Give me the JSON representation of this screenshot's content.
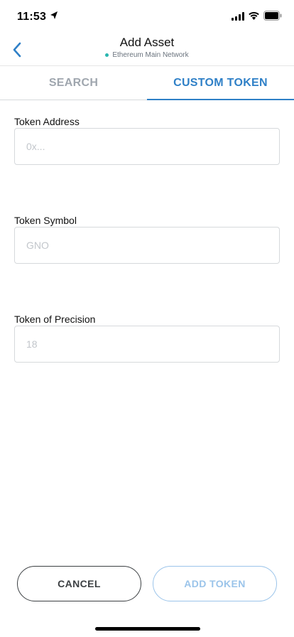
{
  "status_bar": {
    "time": "11:53",
    "icons": [
      "location-arrow-icon",
      "signal-icon",
      "wifi-icon",
      "battery-icon"
    ]
  },
  "header": {
    "title": "Add Asset",
    "network": "Ethereum Main Network",
    "network_status_color": "#29b6af",
    "back_icon": "chevron-left-icon"
  },
  "tabs": [
    {
      "label": "SEARCH",
      "active": false
    },
    {
      "label": "CUSTOM TOKEN",
      "active": true
    }
  ],
  "form": {
    "address": {
      "label": "Token Address",
      "placeholder": "0x...",
      "value": ""
    },
    "symbol": {
      "label": "Token Symbol",
      "placeholder": "GNO",
      "value": ""
    },
    "precision": {
      "label": "Token of Precision",
      "placeholder": "18",
      "value": ""
    }
  },
  "buttons": {
    "cancel": "CANCEL",
    "add": "ADD TOKEN"
  },
  "colors": {
    "accent": "#2f80c7",
    "accent_disabled": "#9bc4ea",
    "inactive_tab": "#9fa6ae"
  }
}
